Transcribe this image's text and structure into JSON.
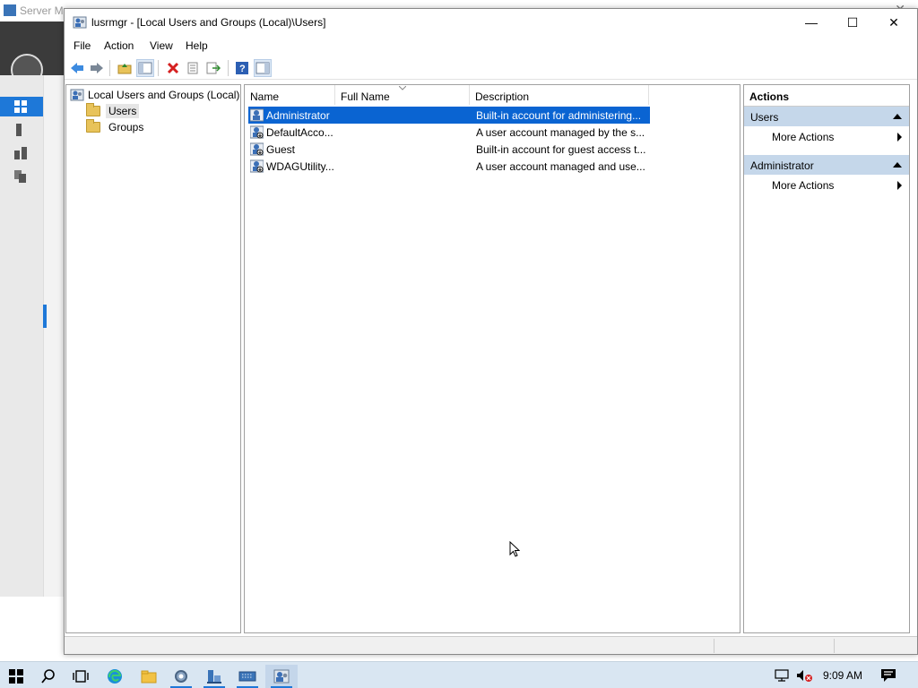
{
  "background": {
    "title": "Server Ma",
    "close_glyph": "✕"
  },
  "window": {
    "title": "lusrmgr - [Local Users and Groups (Local)\\Users]",
    "minimize_glyph": "—",
    "maximize_glyph": "☐",
    "close_glyph": "✕"
  },
  "menu": [
    "File",
    "Action",
    "View",
    "Help"
  ],
  "toolbar_icons": [
    "back-icon",
    "forward-icon",
    "up-folder-icon",
    "show-hide-tree-icon",
    "delete-icon",
    "properties-icon",
    "export-list-icon",
    "help-icon",
    "show-hide-action-pane-icon"
  ],
  "tree": {
    "root": "Local Users and Groups (Local)",
    "children": [
      "Users",
      "Groups"
    ],
    "selected": "Users"
  },
  "list": {
    "columns": [
      "Name",
      "Full Name",
      "Description"
    ],
    "rows": [
      {
        "name": "Administrator",
        "full_name": "",
        "description": "Built-in account for administering..."
      },
      {
        "name": "DefaultAcco...",
        "full_name": "",
        "description": "A user account managed by the s..."
      },
      {
        "name": "Guest",
        "full_name": "",
        "description": "Built-in account for guest access t..."
      },
      {
        "name": "WDAGUtility...",
        "full_name": "",
        "description": "A user account managed and use..."
      }
    ],
    "selected_row": 0
  },
  "actions": {
    "header": "Actions",
    "sections": [
      {
        "title": "Users",
        "items": [
          "More Actions"
        ]
      },
      {
        "title": "Administrator",
        "items": [
          "More Actions"
        ]
      }
    ]
  },
  "taskbar": {
    "clock": "9:09 AM",
    "icons": [
      "start-icon",
      "search-icon",
      "task-view-icon",
      "edge-icon",
      "file-explorer-icon",
      "server-manager-gear-icon",
      "server-manager-icon",
      "keyboard-icon",
      "lusrmgr-icon"
    ]
  },
  "colors": {
    "selection": "#0a64d2",
    "action_section": "#c5d7ea",
    "taskbar": "#d9e6f2"
  }
}
